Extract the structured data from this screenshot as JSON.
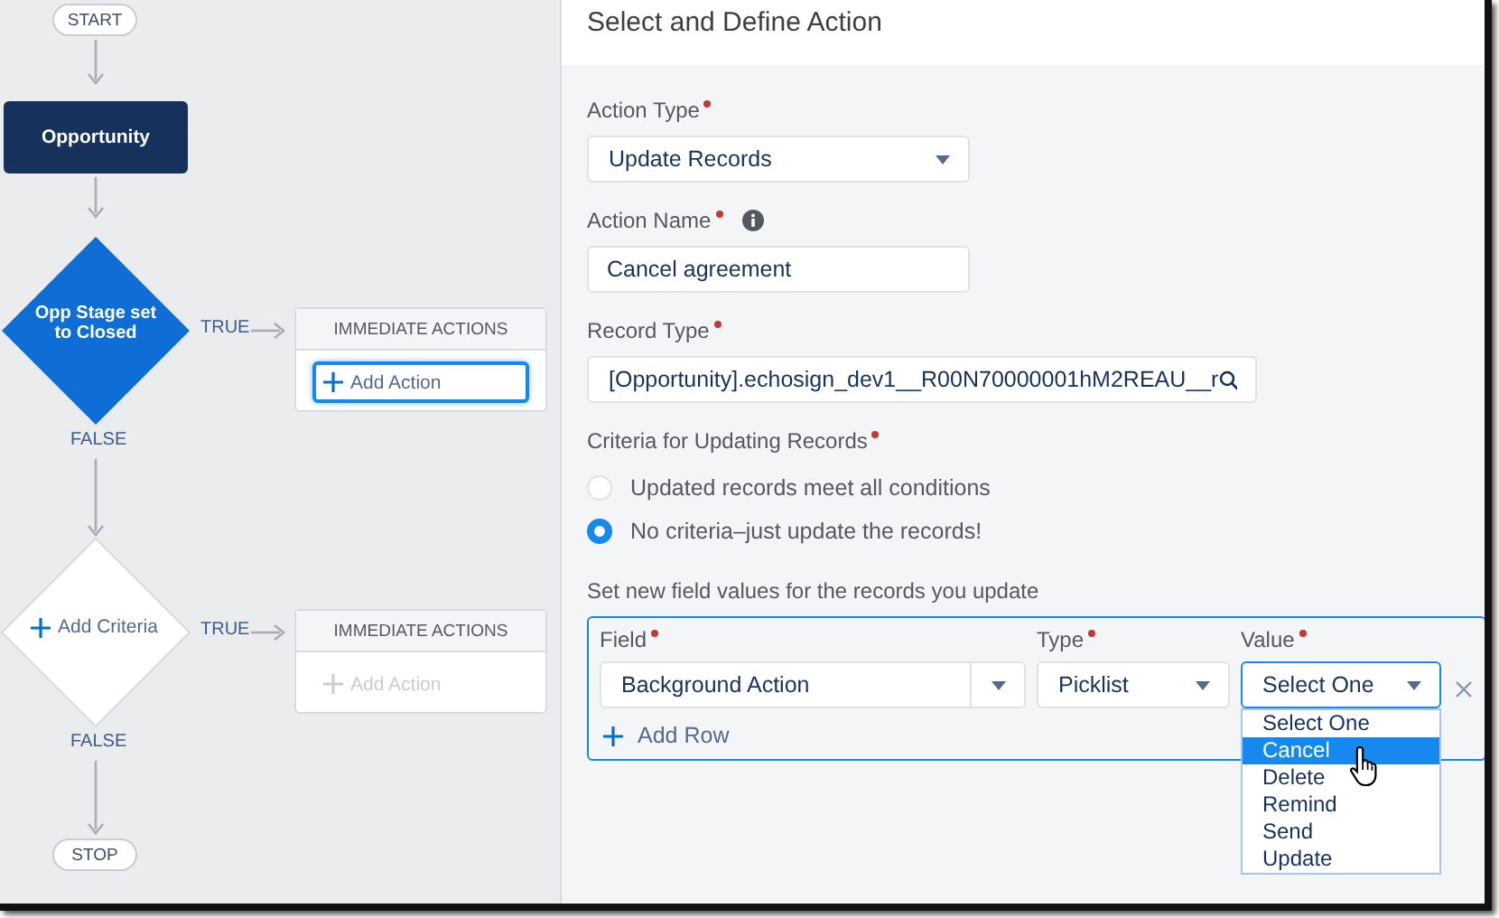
{
  "flow": {
    "start": "START",
    "object_node": "Opportunity",
    "criteria": [
      {
        "kind": "defined",
        "label": "Opp Stage set to Closed",
        "true_label": "TRUE",
        "false_label": "FALSE",
        "actions": {
          "title": "IMMEDIATE ACTIONS",
          "add_label": "Add Action",
          "active": true
        }
      },
      {
        "kind": "add",
        "label": "Add Criteria",
        "true_label": "TRUE",
        "false_label": "FALSE",
        "actions": {
          "title": "IMMEDIATE ACTIONS",
          "add_label": "Add Action",
          "active": false
        }
      }
    ],
    "stop": "STOP"
  },
  "panel": {
    "title": "Select and Define Action",
    "action_type": {
      "label": "Action Type",
      "required": true,
      "value": "Update Records"
    },
    "action_name": {
      "label": "Action Name",
      "required": true,
      "value": "Cancel agreement"
    },
    "record_type": {
      "label": "Record Type",
      "required": true,
      "value": "[Opportunity].echosign_dev1__R00N70000001hM2REAU__r"
    },
    "criteria": {
      "label": "Criteria for Updating Records",
      "required": true,
      "options": [
        {
          "label": "Updated records meet all conditions",
          "selected": false
        },
        {
          "label": "No criteria–just update the records!",
          "selected": true
        }
      ]
    },
    "field_values": {
      "label": "Set new field values for the records you update",
      "field": {
        "label": "Field",
        "required": true,
        "value": "Background Action"
      },
      "type": {
        "label": "Type",
        "required": true,
        "value": "Picklist"
      },
      "value": {
        "label": "Value",
        "required": true,
        "value": "Select One",
        "open": true,
        "options": [
          {
            "label": "Select One",
            "highlighted": false
          },
          {
            "label": "Cancel",
            "highlighted": true
          },
          {
            "label": "Delete",
            "highlighted": false
          },
          {
            "label": "Remind",
            "highlighted": false
          },
          {
            "label": "Send",
            "highlighted": false
          },
          {
            "label": "Update",
            "highlighted": false
          }
        ]
      },
      "add_row": "Add Row"
    }
  }
}
